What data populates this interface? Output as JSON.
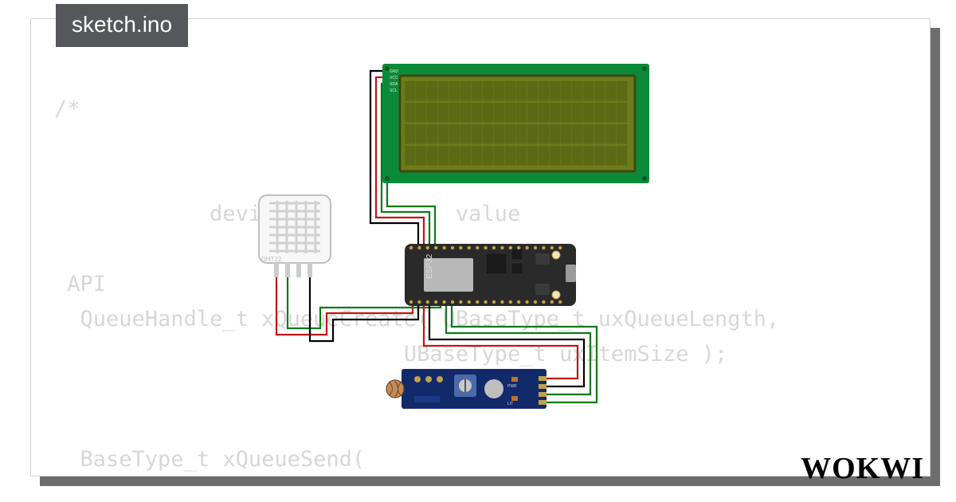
{
  "tab": {
    "title": "sketch.ino"
  },
  "code_lines": [
    "/*",
    "",
    "",
    "            deviceID           value",
    "",
    " API",
    "  QueueHandle_t xQueueCreate( UBaseType_t uxQueueLength,",
    "                           UBaseType_t uxItemSize );",
    "",
    "",
    "  BaseType_t xQueueSend("
  ],
  "lcd": {
    "pin_labels": [
      "GND",
      "VCC",
      "SDA",
      "SCL"
    ],
    "rows": 4,
    "cols": 20
  },
  "dht22": {
    "label": "DHT22",
    "pins": 4
  },
  "esp32": {
    "label": "ESP32"
  },
  "ldr": {
    "pins": 4,
    "leds": [
      "PWR",
      "LIT"
    ]
  },
  "wires": {
    "power_color": "#c11515",
    "ground_color": "#000000",
    "signal_color": "#0e7a17"
  },
  "branding": {
    "logo": "WOKWI"
  }
}
